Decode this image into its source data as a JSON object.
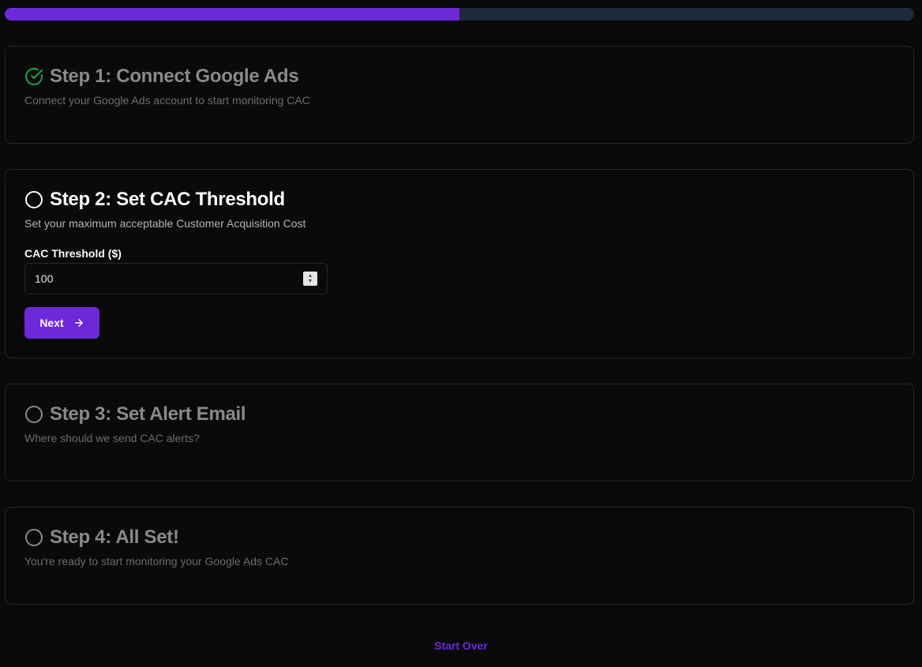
{
  "progress": {
    "percent": 50
  },
  "steps": [
    {
      "title": "Step 1: Connect Google Ads",
      "description": "Connect your Google Ads account to start monitoring CAC",
      "status_icon": "check-circle-icon",
      "status": "complete"
    },
    {
      "title": "Step 2: Set CAC Threshold",
      "description": "Set your maximum acceptable Customer Acquisition Cost",
      "status_icon": "circle-icon",
      "status": "active",
      "field_label": "CAC Threshold ($)",
      "field_value": "100",
      "button_label": "Next",
      "button_icon": "arrow-right-icon"
    },
    {
      "title": "Step 3: Set Alert Email",
      "description": "Where should we send CAC alerts?",
      "status_icon": "circle-icon",
      "status": "pending"
    },
    {
      "title": "Step 4: All Set!",
      "description": "You're ready to start monitoring your Google Ads CAC",
      "status_icon": "circle-icon",
      "status": "pending"
    }
  ],
  "start_over_label": "Start Over",
  "colors": {
    "accent": "#6d28d9",
    "success": "#16a34a",
    "track": "#1e293b"
  }
}
